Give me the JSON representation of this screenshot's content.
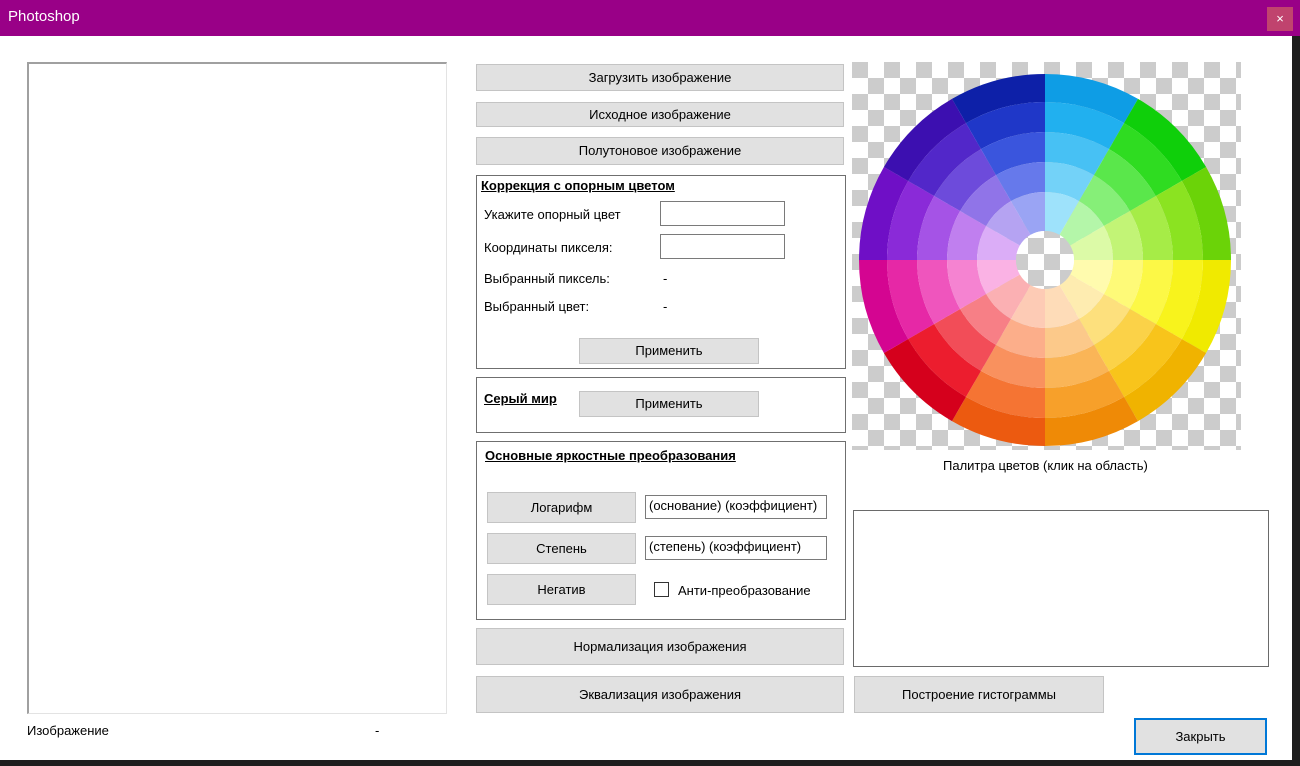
{
  "window": {
    "title": "Photoshop",
    "close_label": "×",
    "title_bar_color": "#990087"
  },
  "image_panel": {
    "caption": "Изображение",
    "value": "-"
  },
  "buttons": {
    "load": "Загрузить изображение",
    "original": "Исходное изображение",
    "grayscale": "Полутоновое изображение",
    "normalize": "Нормализация изображения",
    "equalize": "Эквализация изображения",
    "histogram": "Построение гистограммы",
    "close": "Закрыть"
  },
  "reference_correction": {
    "title": "Коррекция с опорным цветом",
    "ref_color_label": "Укажите опорный цвет",
    "ref_color_value": "",
    "pixel_coords_label": "Координаты пикселя:",
    "pixel_coords_value": "",
    "selected_pixel_label": "Выбранный пиксель:",
    "selected_pixel_value": "-",
    "selected_color_label": "Выбранный цвет:",
    "selected_color_value": "-",
    "apply_label": "Применить"
  },
  "gray_world": {
    "title": "Серый мир",
    "apply_label": "Применить"
  },
  "brightness": {
    "title": "Основные яркостные преобразования",
    "log_label": "Логарифм",
    "log_params": "(основание) (коэффициент)",
    "power_label": "Степень",
    "power_params": "(степень) (коэффициент)",
    "negative_label": "Негатив",
    "anti_transform_label": "Анти-преобразование",
    "anti_transform_checked": false
  },
  "palette": {
    "caption": "Палитра цветов (клик на область)",
    "sectors": [
      {
        "name": "blue-cyan",
        "colors": [
          "#0e9de5",
          "#21b0ef",
          "#47c1f4",
          "#73d2f8",
          "#9ee2fb"
        ]
      },
      {
        "name": "green",
        "colors": [
          "#0fcf0a",
          "#2fdc21",
          "#5ae74b",
          "#86ef78",
          "#b4f6a9"
        ]
      },
      {
        "name": "yellow-green",
        "colors": [
          "#6bd308",
          "#8be321",
          "#a6ec47",
          "#c2f476",
          "#dcfaa7"
        ]
      },
      {
        "name": "yellow",
        "colors": [
          "#f0ea00",
          "#f8f31c",
          "#fcf846",
          "#fefa78",
          "#fffbae"
        ]
      },
      {
        "name": "yellow-orange",
        "colors": [
          "#f0b300",
          "#f8c41b",
          "#fbd248",
          "#fde07d",
          "#feecb0"
        ]
      },
      {
        "name": "orange",
        "colors": [
          "#ef8a06",
          "#f7a02a",
          "#fab557",
          "#fcc98a",
          "#fedcb8"
        ]
      },
      {
        "name": "red-orange",
        "colors": [
          "#ec5a10",
          "#f57433",
          "#f9915e",
          "#fcae8a",
          "#fdcbb5"
        ]
      },
      {
        "name": "red",
        "colors": [
          "#d5001c",
          "#ec1d2e",
          "#f24d58",
          "#f77f86",
          "#fbb0b3"
        ]
      },
      {
        "name": "red-violet",
        "colors": [
          "#d40591",
          "#e628a6",
          "#ef55bd",
          "#f583d1",
          "#fab2e4"
        ]
      },
      {
        "name": "violet",
        "colors": [
          "#6f0fc6",
          "#8a2ad8",
          "#a553e6",
          "#c07fef",
          "#dbadf7"
        ]
      },
      {
        "name": "blue-violet",
        "colors": [
          "#3c0fb0",
          "#5227c9",
          "#6d4bdb",
          "#9074e8",
          "#b5a3f2"
        ]
      },
      {
        "name": "blue",
        "colors": [
          "#0d20a8",
          "#1f37c8",
          "#3a55dd",
          "#6679eb",
          "#9aa4f4"
        ]
      }
    ]
  }
}
